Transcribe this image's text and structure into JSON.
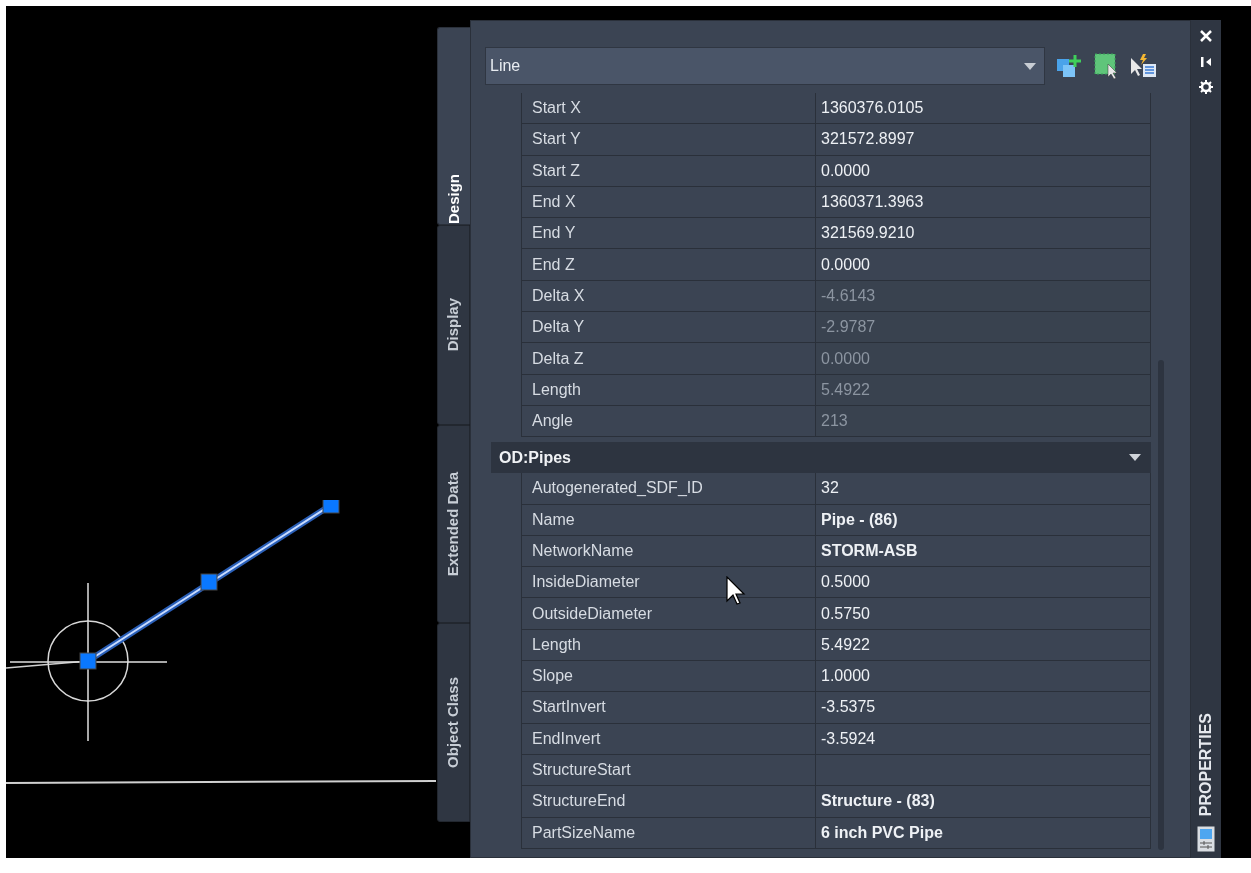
{
  "tabs": [
    {
      "label": "Design",
      "selected": true
    },
    {
      "label": "Display",
      "selected": false
    },
    {
      "label": "Extended Data",
      "selected": false
    },
    {
      "label": "Object Class",
      "selected": false
    }
  ],
  "object_selector": {
    "value": "Line"
  },
  "properties": [
    {
      "name": "Start X",
      "value": "1360376.0105",
      "bold": false,
      "disabled": false
    },
    {
      "name": "Start Y",
      "value": "321572.8997",
      "bold": false,
      "disabled": false
    },
    {
      "name": "Start Z",
      "value": "0.0000",
      "bold": false,
      "disabled": false
    },
    {
      "name": "End X",
      "value": "1360371.3963",
      "bold": false,
      "disabled": false
    },
    {
      "name": "End Y",
      "value": "321569.9210",
      "bold": false,
      "disabled": false
    },
    {
      "name": "End Z",
      "value": "0.0000",
      "bold": false,
      "disabled": false
    },
    {
      "name": "Delta X",
      "value": "-4.6143",
      "bold": false,
      "disabled": true
    },
    {
      "name": "Delta Y",
      "value": "-2.9787",
      "bold": false,
      "disabled": true
    },
    {
      "name": "Delta Z",
      "value": "0.0000",
      "bold": false,
      "disabled": true
    },
    {
      "name": "Length",
      "value": "5.4922",
      "bold": false,
      "disabled": true
    },
    {
      "name": "Angle",
      "value": "213",
      "bold": false,
      "disabled": true
    }
  ],
  "category": {
    "title": "OD:Pipes",
    "expanded": true,
    "rows": [
      {
        "name": "Autogenerated_SDF_ID",
        "value": "32",
        "bold": false,
        "disabled": false
      },
      {
        "name": "Name",
        "value": "Pipe - (86)",
        "bold": true,
        "disabled": false
      },
      {
        "name": "NetworkName",
        "value": "STORM-ASB",
        "bold": true,
        "disabled": false
      },
      {
        "name": "InsideDiameter",
        "value": "0.5000",
        "bold": false,
        "disabled": false
      },
      {
        "name": "OutsideDiameter",
        "value": "0.5750",
        "bold": false,
        "disabled": false
      },
      {
        "name": "Length",
        "value": "5.4922",
        "bold": false,
        "disabled": false
      },
      {
        "name": "Slope",
        "value": "1.0000",
        "bold": false,
        "disabled": false
      },
      {
        "name": "StartInvert",
        "value": "-3.5375",
        "bold": false,
        "disabled": false
      },
      {
        "name": "EndInvert",
        "value": "-3.5924",
        "bold": false,
        "disabled": false
      },
      {
        "name": "StructureStart"
      },
      {
        "name": "StructureEnd",
        "value": "Structure - (83)",
        "bold": true,
        "disabled": false
      },
      {
        "name": "PartSizeName",
        "value": "6 inch PVC Pipe",
        "bold": true,
        "disabled": false
      }
    ]
  },
  "palette_title": "PROPERTIES"
}
